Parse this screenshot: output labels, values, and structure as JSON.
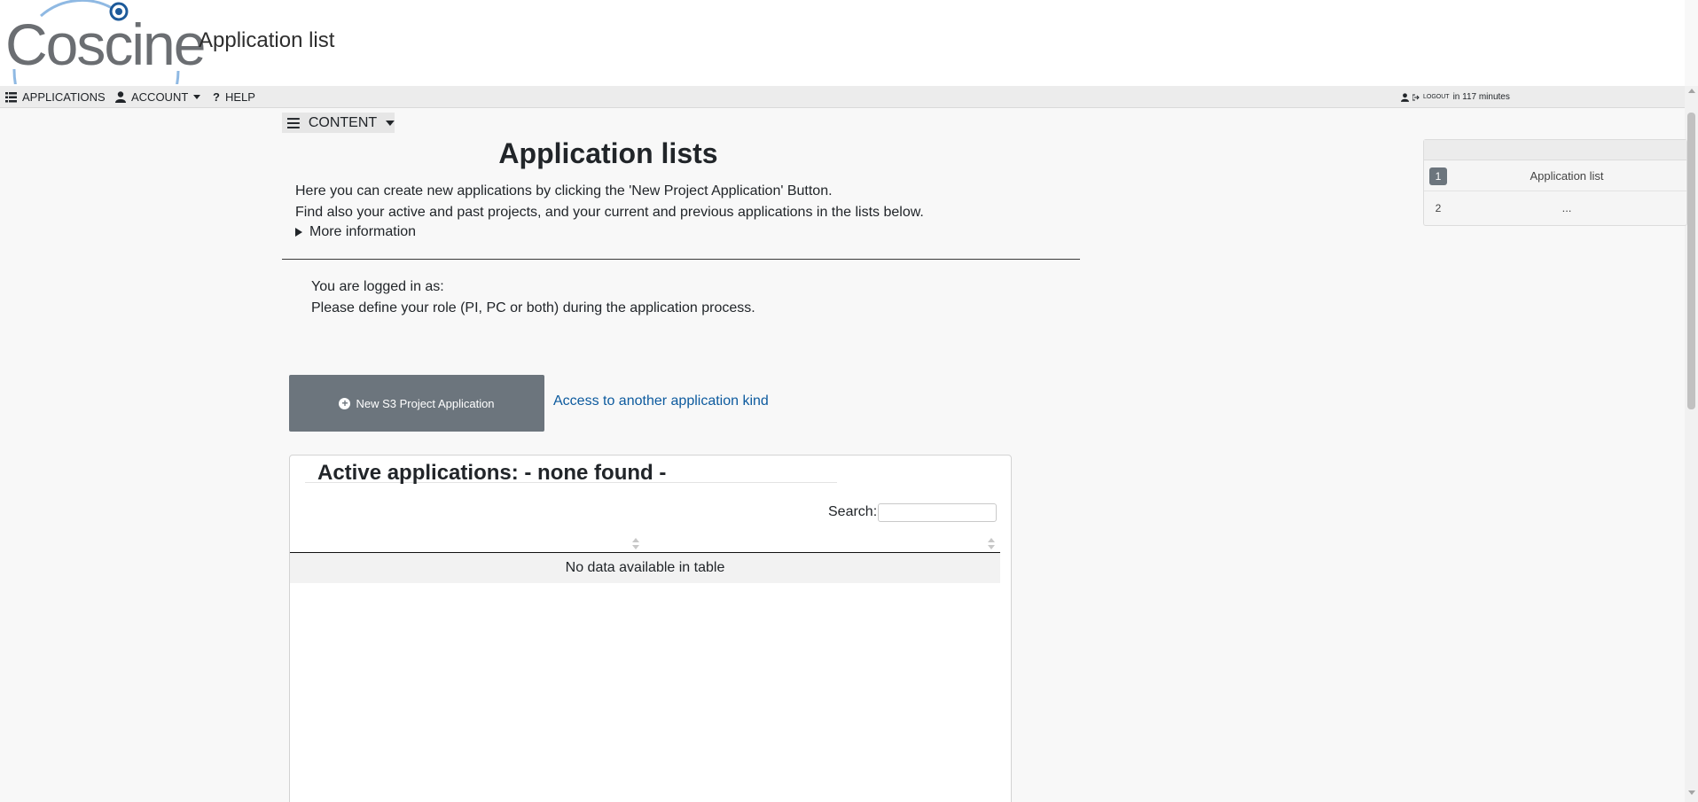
{
  "header": {
    "logo_text": "Coscine",
    "title": "Application list"
  },
  "navbar": {
    "applications": "APPLICATIONS",
    "account": "ACCOUNT",
    "help": "HELP",
    "logout": "LOGOUT",
    "session": "in 117 minutes"
  },
  "content_menu": {
    "label": "CONTENT"
  },
  "main": {
    "heading": "Application lists",
    "intro_line1": "Here you can create new applications by clicking the 'New Project Application' Button.",
    "intro_line2": "Find also your active and past projects, and your current and previous applications in the lists below.",
    "more_info": "More information",
    "logged_in_as": "You are logged in as:",
    "role_hint": "Please define your role (PI, PC or both) during the application process.",
    "new_button": "New S3 Project Application",
    "access_link": "Access to another application kind"
  },
  "active_panel": {
    "title": "Active applications: - none found -",
    "search_label": "Search:",
    "search_value": "",
    "empty_message": "No data available in table"
  },
  "toc": {
    "items": [
      {
        "num": "1",
        "label": "Application list"
      },
      {
        "num": "2",
        "label": "..."
      }
    ]
  },
  "colors": {
    "button": "#6c757d",
    "link": "#0c5a9e",
    "logo_accent": "#6fa8dc"
  }
}
